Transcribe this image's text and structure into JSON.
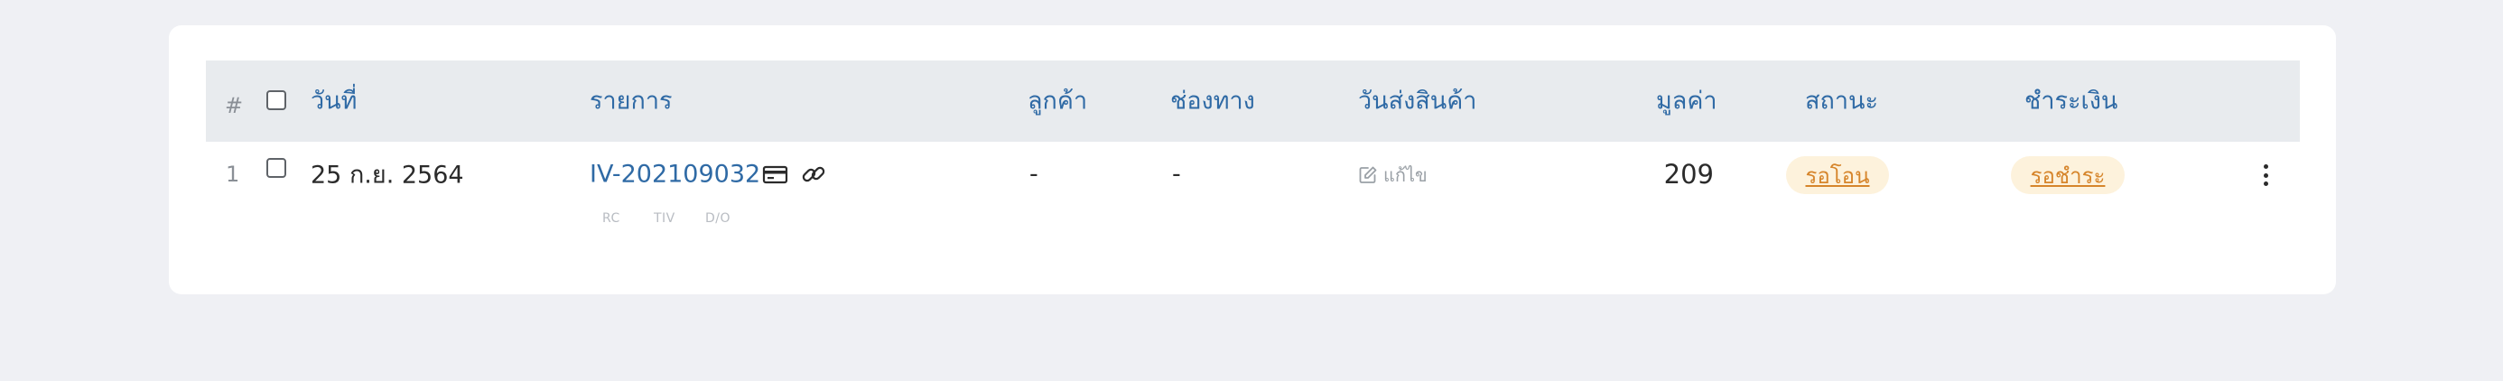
{
  "table": {
    "headers": {
      "index": "#",
      "date": "วันที่",
      "item": "รายการ",
      "customer": "ลูกค้า",
      "channel": "ช่องทาง",
      "ship_date": "วันส่งสินค้า",
      "amount": "มูลค่า",
      "status": "สถานะ",
      "payment": "ชำระเงิน"
    },
    "rows": [
      {
        "index": "1",
        "date": "25 ก.ย. 2564",
        "invoice": "IV-202109032",
        "sub_tags": [
          "RC",
          "TIV",
          "D/O"
        ],
        "customer": "-",
        "channel": "-",
        "ship_date_edit": "แก้ไข",
        "amount": "209",
        "status": "รอโอน",
        "payment": "รอชำระ"
      }
    ]
  },
  "icons": {
    "card": "credit-card-icon",
    "link": "link-icon",
    "edit": "edit-icon",
    "more": "more-vertical-icon"
  },
  "colors": {
    "header_text": "#2f6aa5",
    "link": "#2f6aa5",
    "badge_bg": "#fdf2dc",
    "badge_text": "#d6852b"
  }
}
